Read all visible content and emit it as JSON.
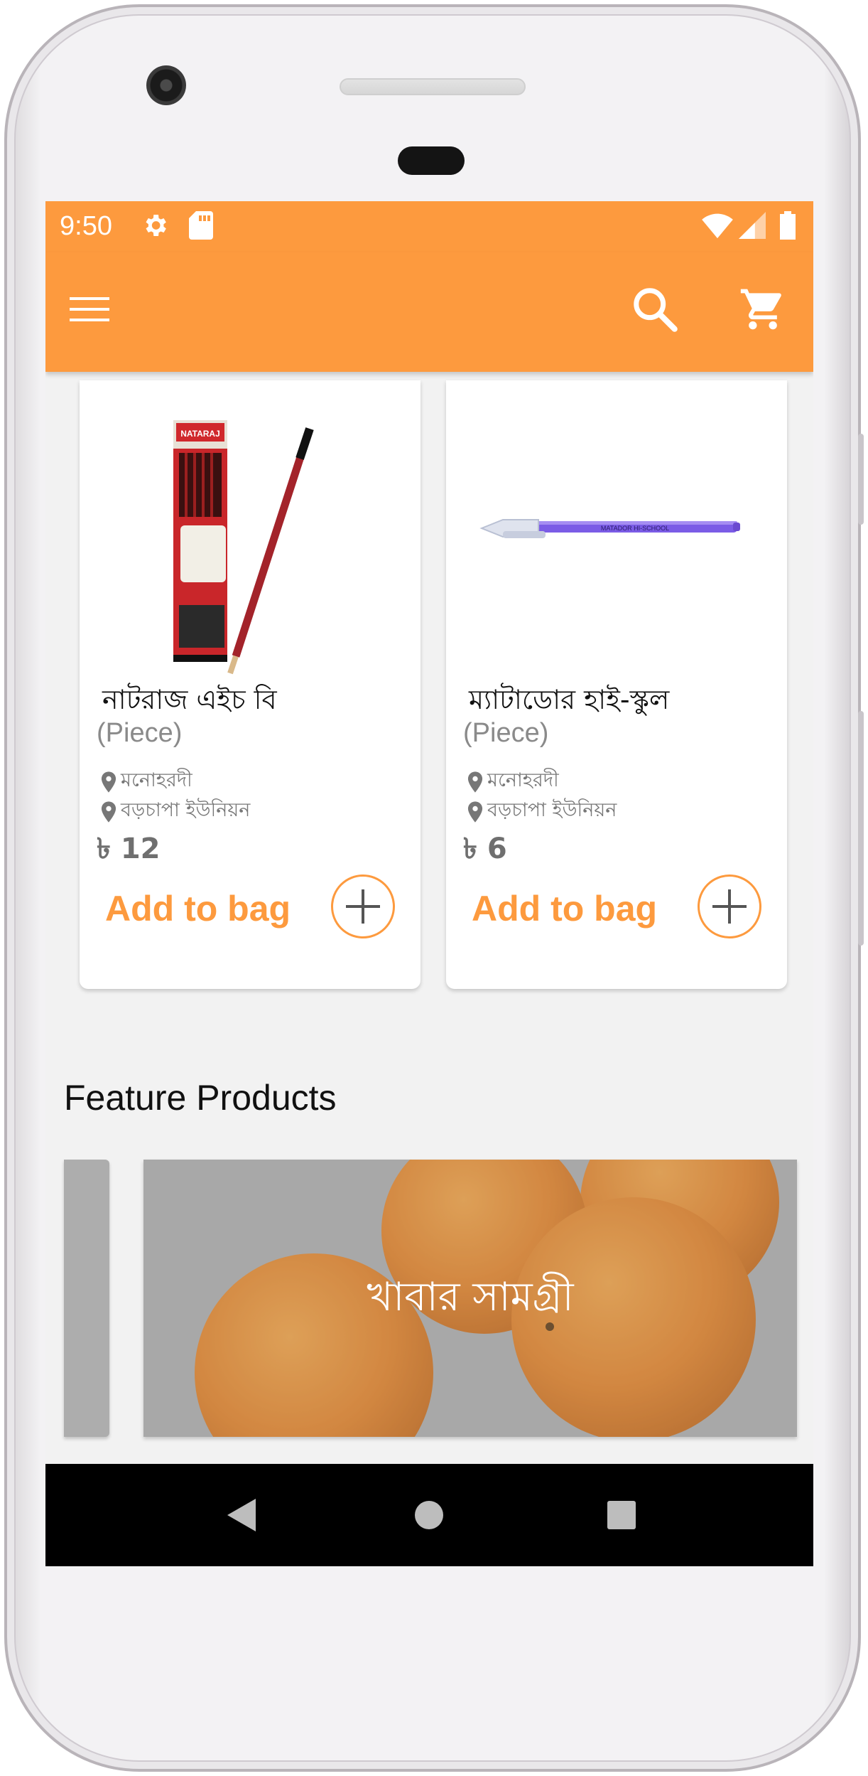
{
  "status_bar": {
    "time": "9:50",
    "icons": [
      "settings-icon",
      "sd-card-icon",
      "wifi-icon",
      "cell-signal-icon",
      "battery-icon"
    ]
  },
  "toolbar": {
    "icons": [
      "menu-icon",
      "search-icon",
      "cart-icon"
    ],
    "color": "#fd9a3e"
  },
  "products": [
    {
      "name": "নাটরাজ এইচ বি",
      "unit": "(Piece)",
      "location_line1": "মনোহরদী",
      "location_line2": "বড়চাপা ইউনিয়ন",
      "price": "৳ 12",
      "add_label": "Add to bag",
      "image": "pencil-box-image"
    },
    {
      "name": "ম্যাটাডোর হাই-স্কুল",
      "unit": "(Piece)",
      "location_line1": "মনোহরদী",
      "location_line2": "বড়চাপা ইউনিয়ন",
      "price": "৳ 6",
      "add_label": "Add to bag",
      "image": "pen-image"
    }
  ],
  "featured": {
    "title": "Feature Products",
    "banner_label": "খাবার সামগ্রী",
    "banner_image": "oranges-image"
  },
  "nav_bar": {
    "icons": [
      "back-icon",
      "home-icon",
      "recents-icon"
    ]
  },
  "colors": {
    "accent": "#fd9a3e",
    "background": "#f2f2f2"
  }
}
